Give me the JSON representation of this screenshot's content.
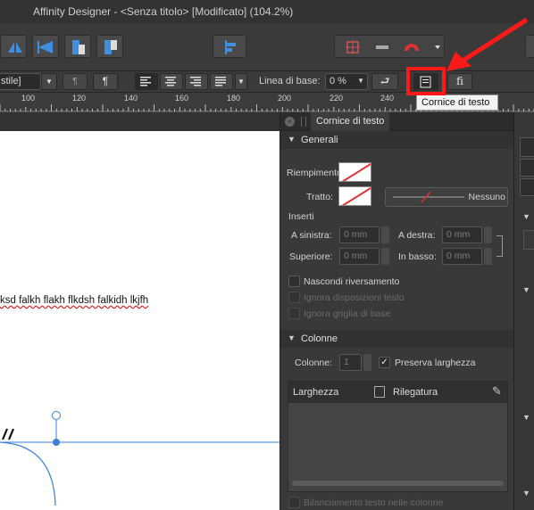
{
  "window": {
    "title": "Affinity Designer - <Senza titolo> [Modificato] (104.2%)"
  },
  "toolbar2": {
    "style_value": "stile]",
    "para_button": "¶",
    "baseline_label": "Linea di base:",
    "baseline_value": "0 %"
  },
  "ruler": {
    "ticks": [
      "100",
      "120",
      "140",
      "160",
      "180",
      "200",
      "220",
      "240"
    ]
  },
  "canvas": {
    "text_line": "ksd falkh flakh flkdsh falkidh lkjfh"
  },
  "tooltip": {
    "text": "Cornice di testo"
  },
  "panel": {
    "tab_label": "Cornice di testo",
    "general": {
      "title": "Generali",
      "fill_label": "Riempimento:",
      "stroke_label": "Tratto:",
      "stroke_value": "Nessuno",
      "insets_label": "Inserti",
      "left_label": "A sinistra:",
      "right_label": "A destra:",
      "top_label": "Superiore:",
      "bottom_label": "In basso:",
      "left_value": "0 mm",
      "right_value": "0 mm",
      "top_value": "0 mm",
      "bottom_value": "0 mm",
      "hide_overflow": "Nascondi riversamento",
      "ignore_wrap": "Ignora disposizioni testo",
      "ignore_grid": "Ignora griglia di base"
    },
    "columns": {
      "title": "Colonne",
      "count_label": "Colonne:",
      "count_value": "1",
      "preserve_width": "Preserva larghezza",
      "width_header": "Larghezza",
      "gutter_header": "Rilegatura",
      "balance": "Bilanciamento testo nelle colonne"
    }
  },
  "colors": {
    "accent_red": "#ff1a1a",
    "selection_blue": "#3b7fd9"
  }
}
